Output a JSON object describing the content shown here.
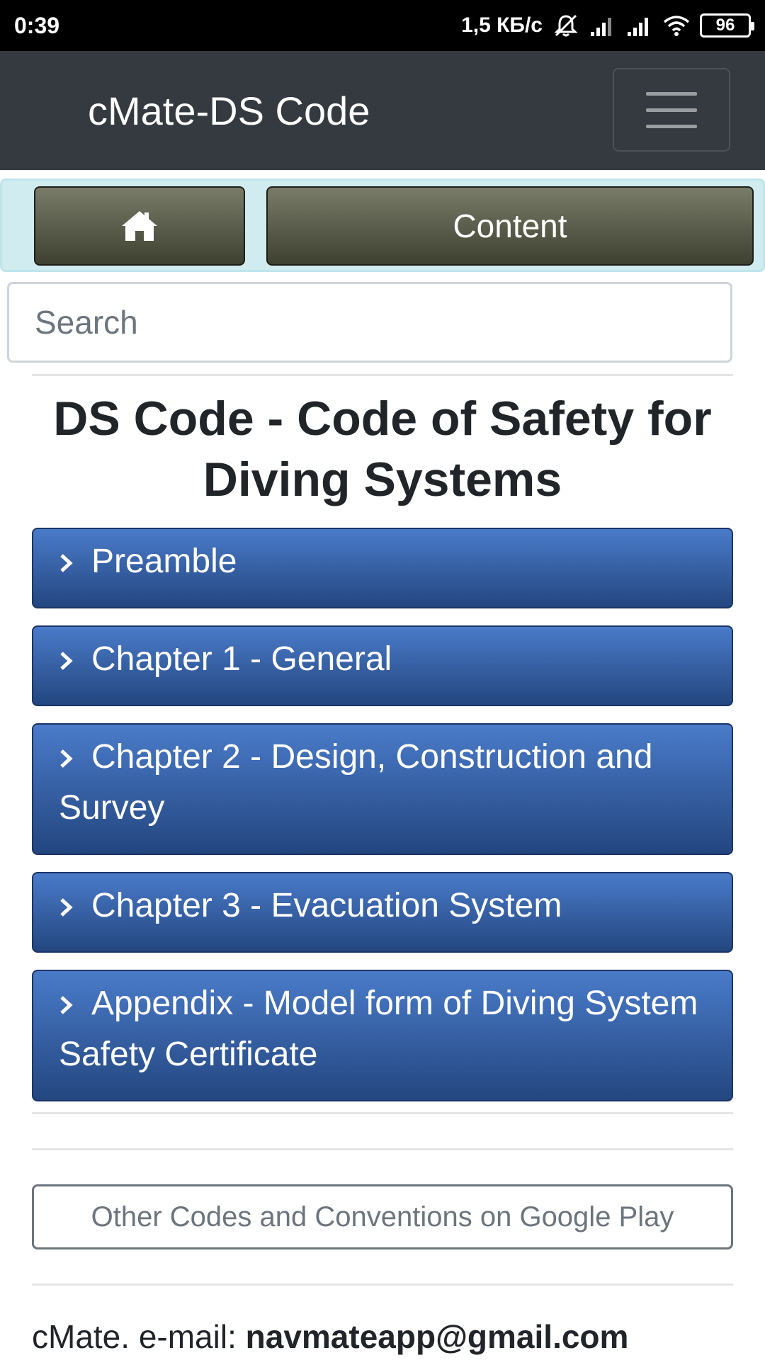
{
  "status_bar": {
    "time": "0:39",
    "network_speed": "1,5 КБ/с",
    "battery": "96"
  },
  "navbar": {
    "brand": "cMate-DS Code"
  },
  "button_bar": {
    "content_label": "Content"
  },
  "search": {
    "placeholder": "Search"
  },
  "page": {
    "title": "DS Code - Code of Safety for Diving Systems"
  },
  "chapters": [
    {
      "label": "Preamble"
    },
    {
      "label": "Chapter 1 - General"
    },
    {
      "label": "Chapter 2 - Design, Construction and Survey"
    },
    {
      "label": "Chapter 3 - Evacuation System"
    },
    {
      "label": "Appendix - Model form of Diving System Safety Certificate"
    }
  ],
  "other_codes": {
    "label": "Other Codes and Conventions on Google Play"
  },
  "footer": {
    "prefix": "cMate. e-mail: ",
    "email": "navmateapp@gmail.com"
  },
  "colors": {
    "navbar_bg": "#343a40",
    "chapter_blue": "#3a65ad",
    "button_olive": "#5c5e4c",
    "info_bar": "#d1ecf1"
  }
}
